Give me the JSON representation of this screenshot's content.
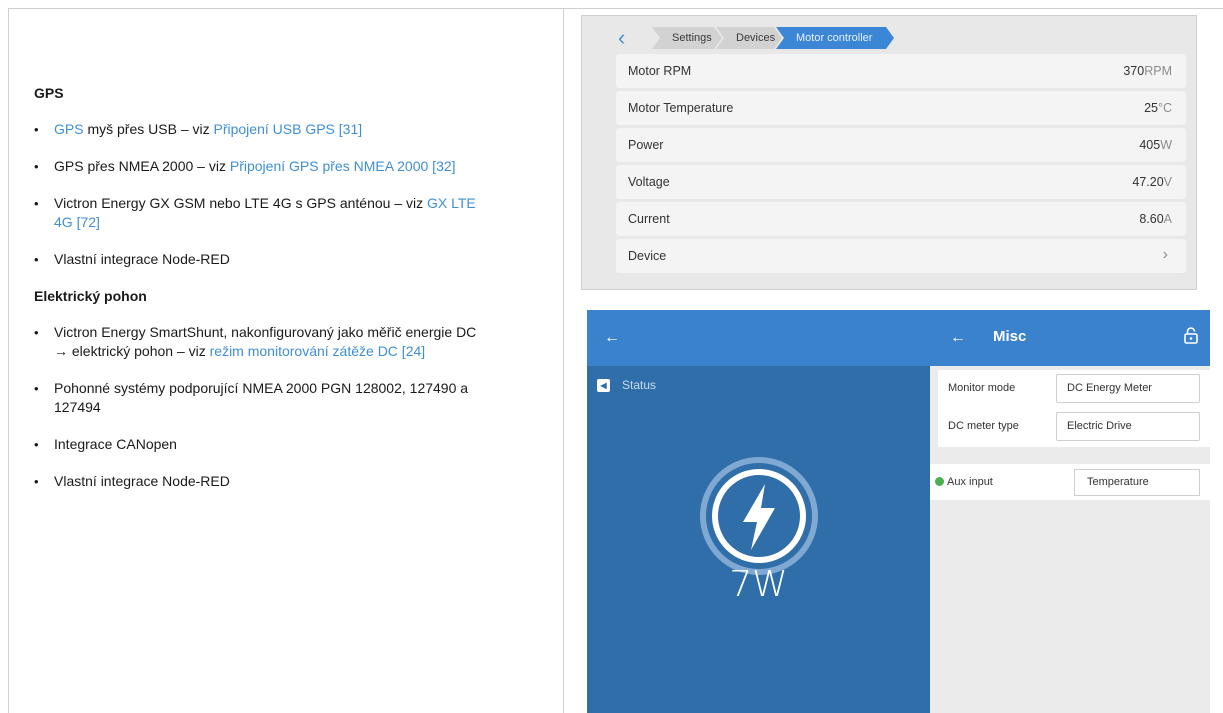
{
  "doc": {
    "gps_heading": "GPS",
    "gps_items": [
      {
        "parts": [
          {
            "link": "GPS"
          },
          {
            "text": " myš přes USB – viz "
          },
          {
            "link": "Připojení USB GPS [31]"
          }
        ]
      },
      {
        "parts": [
          {
            "text": "GPS přes NMEA 2000 – viz "
          },
          {
            "link": "Připojení GPS přes NMEA 2000 [32]"
          }
        ]
      },
      {
        "parts": [
          {
            "text": "Victron Energy GX GSM nebo LTE 4G s GPS anténou – viz "
          },
          {
            "link": "GX LTE 4G [72]"
          }
        ]
      },
      {
        "parts": [
          {
            "text": "Vlastní integrace Node-RED"
          }
        ]
      }
    ],
    "drive_heading": "Elektrický pohon",
    "drive_items": [
      {
        "parts": [
          {
            "text": "Victron Energy SmartShunt, nakonfigurovaný jako měřič energie DC → elektrický pohon – viz "
          },
          {
            "link": "režim monitorování zátěže DC [24]"
          }
        ]
      },
      {
        "parts": [
          {
            "text": "Pohonné systémy podporující NMEA 2000 PGN 128002, 127490 a 127494"
          }
        ]
      },
      {
        "parts": [
          {
            "text": "Integrace CANopen"
          }
        ]
      },
      {
        "parts": [
          {
            "text": "Vlastní integrace Node-RED"
          }
        ]
      }
    ]
  },
  "motor_screen": {
    "breadcrumb": [
      "Settings",
      "Devices",
      "Motor controller"
    ],
    "rows": [
      {
        "label": "Motor RPM",
        "value": "370",
        "unit": "RPM"
      },
      {
        "label": "Motor Temperature",
        "value": "25",
        "unit": "°C"
      },
      {
        "label": "Power",
        "value": "405",
        "unit": "W"
      },
      {
        "label": "Voltage",
        "value": "47.20",
        "unit": "V"
      },
      {
        "label": "Current",
        "value": "8.60",
        "unit": "A"
      }
    ],
    "device_label": "Device"
  },
  "gx_screen": {
    "status_label": "Status",
    "power_value": "7W",
    "right_title": "Misc",
    "monitor_mode_label": "Monitor mode",
    "monitor_mode_value": "DC Energy Meter",
    "dc_meter_type_label": "DC meter type",
    "dc_meter_type_value": "Electric Drive",
    "aux_input_label": "Aux input",
    "aux_input_value": "Temperature"
  },
  "colors": {
    "link": "#3f8fd6",
    "accent_blue": "#3b82cc",
    "panel_blue": "#2f6ea8",
    "breadcrumb_active": "#3c86d6",
    "ok_green": "#4caf50"
  }
}
